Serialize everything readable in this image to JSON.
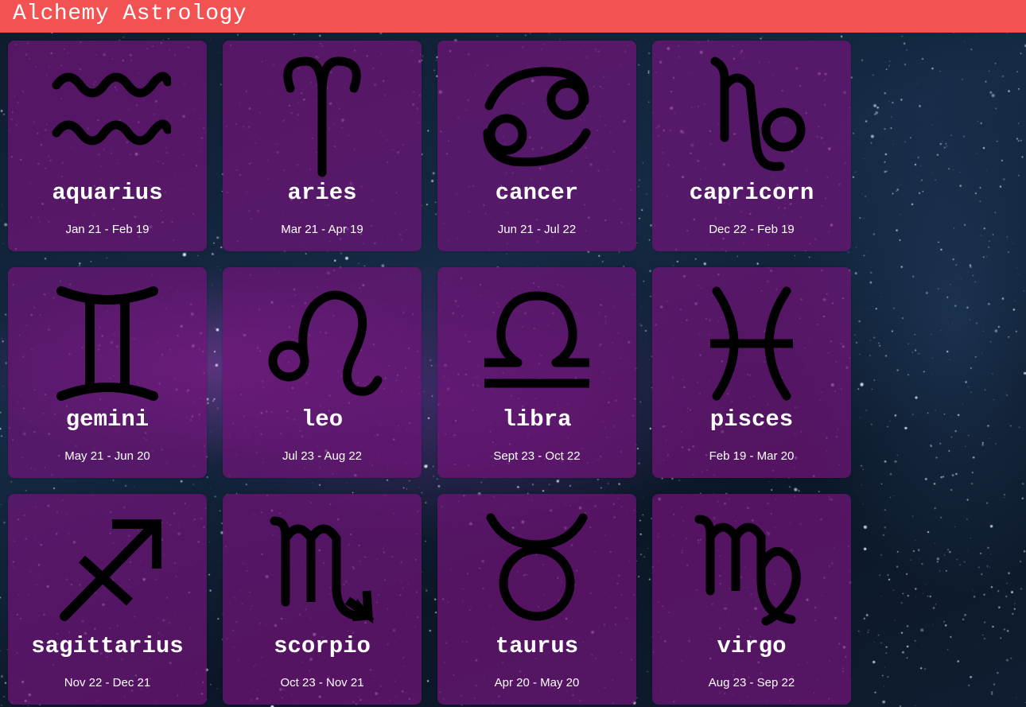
{
  "header": {
    "title": "Alchemy Astrology",
    "background_color": "#f25252"
  },
  "card_color": "#70147a",
  "signs": [
    {
      "name": "aquarius",
      "dates": "Jan 21 - Feb 19",
      "icon": "aquarius-icon"
    },
    {
      "name": "aries",
      "dates": "Mar 21 - Apr 19",
      "icon": "aries-icon"
    },
    {
      "name": "cancer",
      "dates": "Jun 21 - Jul 22",
      "icon": "cancer-icon"
    },
    {
      "name": "capricorn",
      "dates": "Dec 22 - Feb 19",
      "icon": "capricorn-icon"
    },
    {
      "name": "gemini",
      "dates": "May 21 - Jun 20",
      "icon": "gemini-icon"
    },
    {
      "name": "leo",
      "dates": "Jul 23 - Aug 22",
      "icon": "leo-icon"
    },
    {
      "name": "libra",
      "dates": "Sept 23 - Oct 22",
      "icon": "libra-icon"
    },
    {
      "name": "pisces",
      "dates": "Feb 19 - Mar 20",
      "icon": "pisces-icon"
    },
    {
      "name": "sagittarius",
      "dates": "Nov 22 - Dec 21",
      "icon": "sagittarius-icon"
    },
    {
      "name": "scorpio",
      "dates": "Oct 23 - Nov 21",
      "icon": "scorpio-icon"
    },
    {
      "name": "taurus",
      "dates": "Apr 20 - May 20",
      "icon": "taurus-icon"
    },
    {
      "name": "virgo",
      "dates": "Aug 23 - Sep 22",
      "icon": "virgo-icon"
    }
  ]
}
